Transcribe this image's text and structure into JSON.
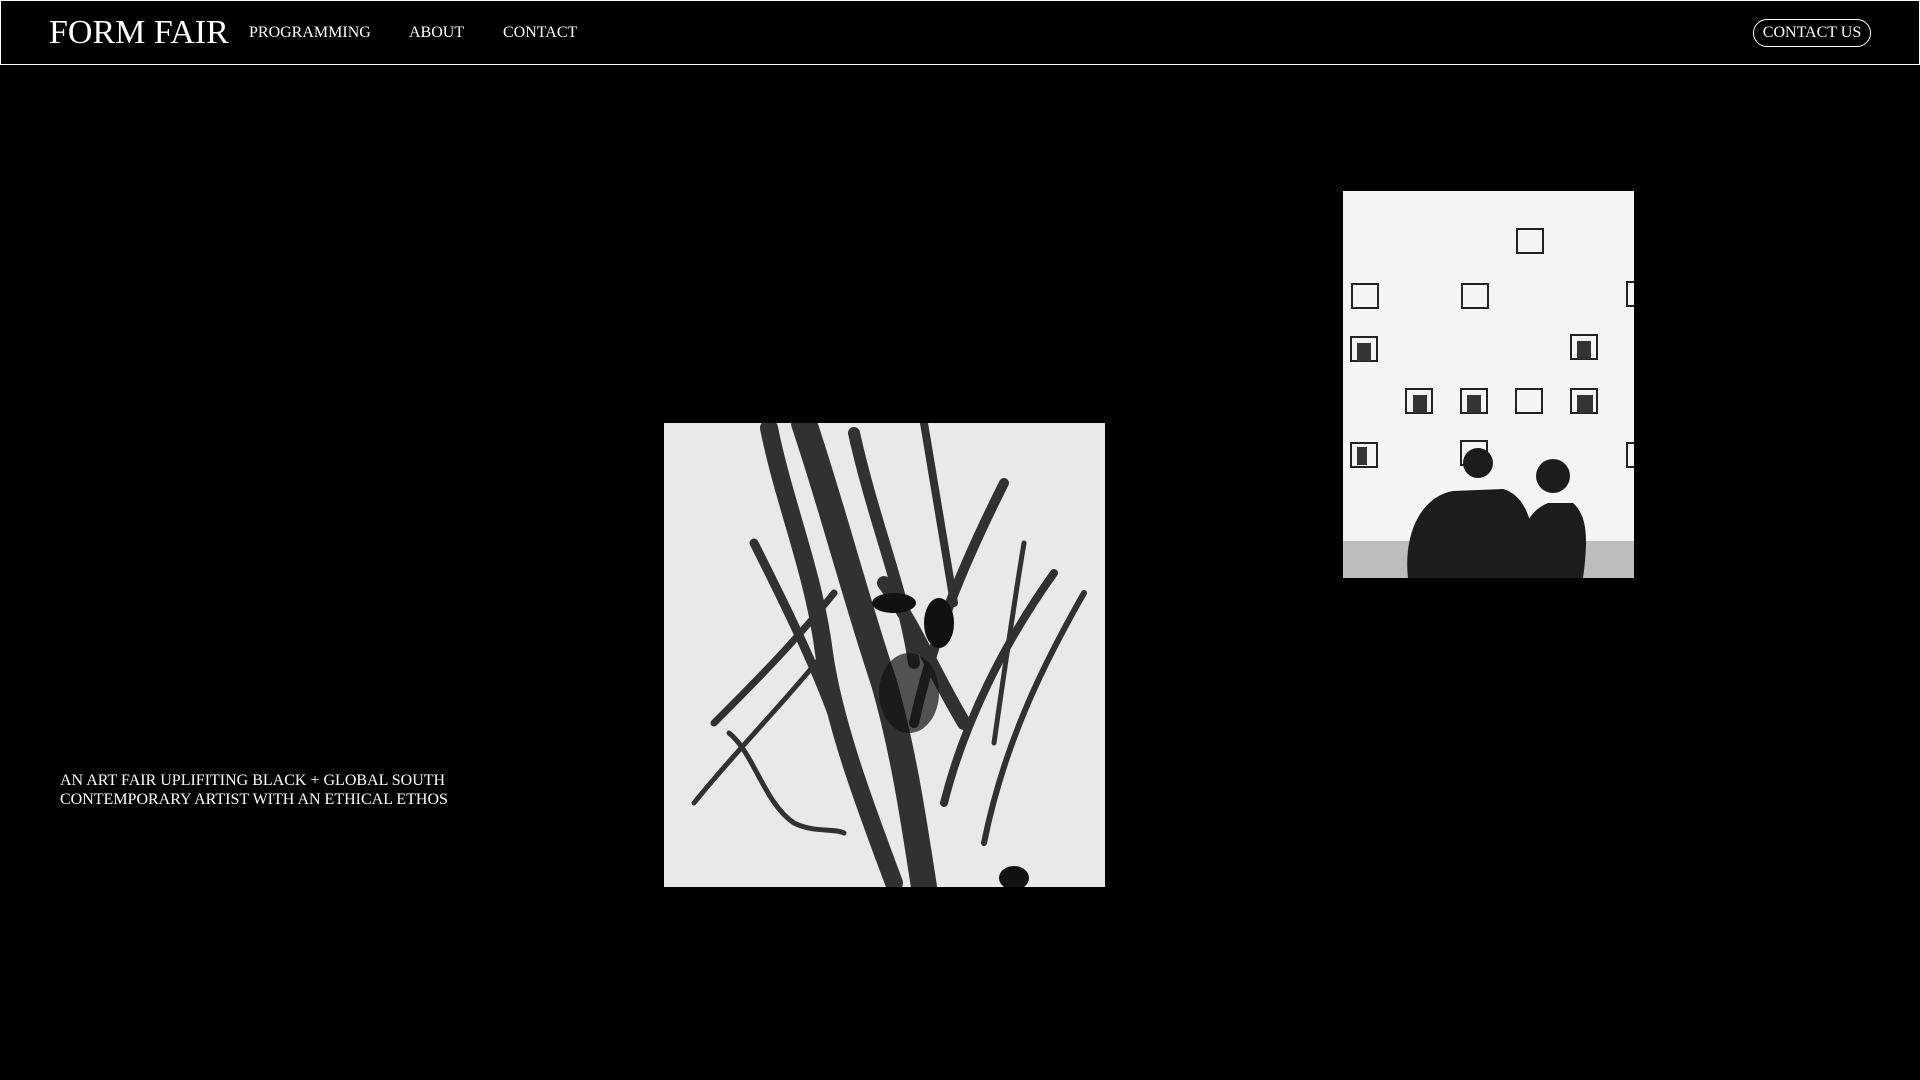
{
  "header": {
    "logo": "FORM FAIR",
    "nav": [
      "PROGRAMMING",
      "ABOUT",
      "CONTACT"
    ],
    "cta_label": "CONTACT US"
  },
  "hero": {
    "tagline_lines": [
      "AN ART FAIR UPLIFITING BLACK + GLOBAL SOUTH",
      "CONTEMPORARY ARTIST WITH AN ETHICAL ETHOS"
    ]
  },
  "colors": {
    "background": "#000000",
    "text": "#ffffff"
  }
}
